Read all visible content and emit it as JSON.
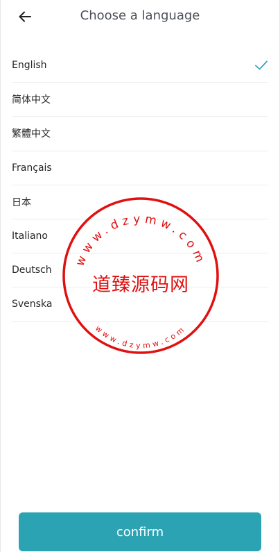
{
  "header": {
    "title": "Choose a language",
    "back_icon": "back-arrow-icon"
  },
  "languages": [
    {
      "label": "English",
      "selected": true
    },
    {
      "label": "简体中文",
      "selected": false
    },
    {
      "label": "繁體中文",
      "selected": false
    },
    {
      "label": "Français",
      "selected": false
    },
    {
      "label": "日本",
      "selected": false
    },
    {
      "label": "Italiano",
      "selected": false
    },
    {
      "label": "Deutsch",
      "selected": false
    },
    {
      "label": "Svenska",
      "selected": false
    }
  ],
  "check_icon": "check-icon",
  "confirm_label": "confirm",
  "watermark": {
    "center_text": "道臻源码网",
    "top_arc": "www.dzymw.com",
    "bottom_arc": "www.dzymw.com"
  },
  "colors": {
    "accent": "#2ba3b3",
    "check": "#3f9fc2",
    "watermark": "#e01010",
    "title": "#4a4f57"
  }
}
